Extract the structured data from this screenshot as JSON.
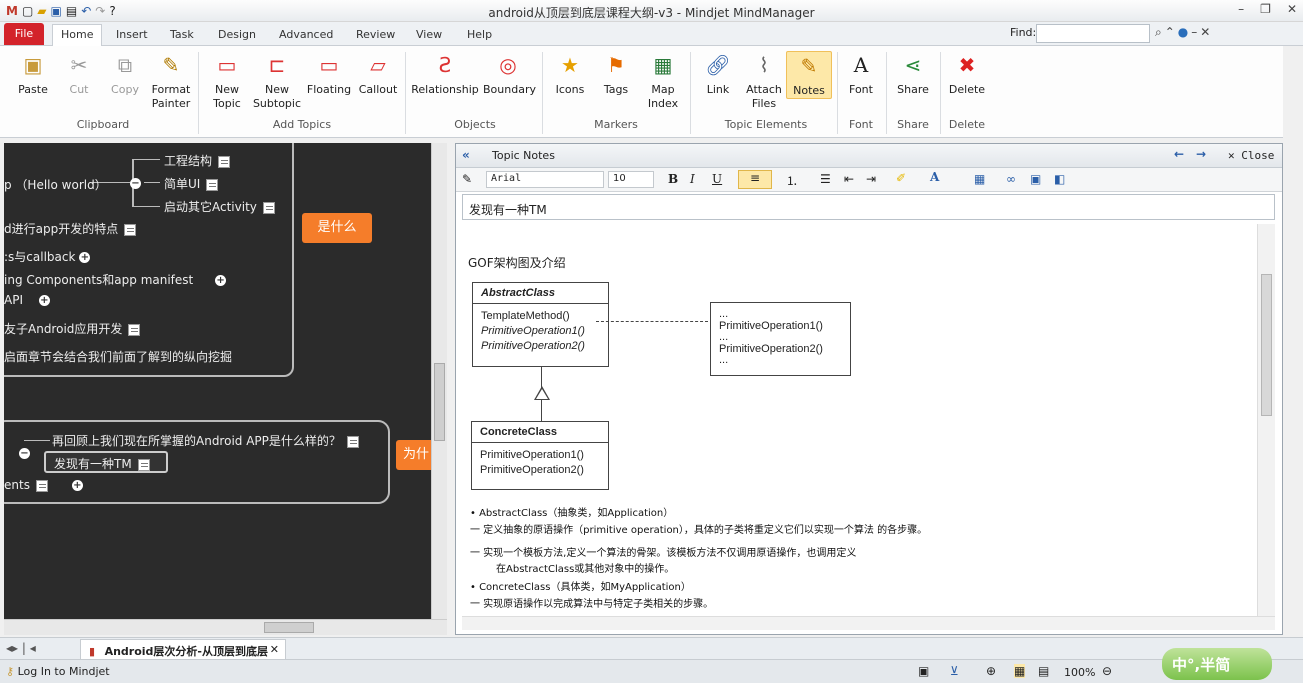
{
  "window": {
    "title": "android从顶层到底层课程大纲-v3 - Mindjet MindManager"
  },
  "ribbon_tabs": [
    "File",
    "Home",
    "Insert",
    "Task",
    "Design",
    "Advanced",
    "Review",
    "View",
    "Help"
  ],
  "find": {
    "label": "Find:",
    "value": ""
  },
  "ribbon": {
    "clipboard": {
      "paste": "Paste",
      "cut": "Cut",
      "copy": "Copy",
      "format_painter": "Format Painter",
      "group": "Clipboard"
    },
    "add_topics": {
      "new_topic": "New Topic",
      "new_subtopic": "New Subtopic",
      "floating": "Floating",
      "callout": "Callout",
      "group": "Add Topics"
    },
    "objects": {
      "relationship": "Relationship",
      "boundary": "Boundary",
      "group": "Objects"
    },
    "markers": {
      "icons": "Icons",
      "tags": "Tags",
      "map_index": "Map Index",
      "group": "Markers"
    },
    "topic_elements": {
      "link": "Link",
      "attach_files": "Attach Files",
      "notes": "Notes",
      "group": "Topic Elements"
    },
    "font": {
      "font": "Font",
      "group": "Font"
    },
    "share": {
      "share": "Share",
      "group": "Share"
    },
    "delete": {
      "delete": "Delete",
      "group": "Delete"
    }
  },
  "map": {
    "topics": [
      "工程结构",
      "p （Hello world）",
      "简单UI",
      "启动其它Activity",
      "d进行app开发的特点",
      "是什么",
      ":s与callback",
      "ing Components和app manifest",
      "API",
      "友子Android应用开发",
      "启面章节会结合我们前面了解到的纵向挖掘",
      "再回顾上我们现在所掌握的Android APP是什么样的？",
      "发现有一种TM",
      "为什",
      "ents"
    ]
  },
  "notes_panel": {
    "title": "Topic Notes",
    "close_label": "Close",
    "font": "Arial",
    "size": "10",
    "topic": "发现有一种TM",
    "heading": "GOF架构图及介绍",
    "uml": {
      "abstract_title": "AbstractClass",
      "abstract_methods": [
        "TemplateMethod()",
        "PrimitiveOperation1()",
        "PrimitiveOperation2()"
      ],
      "note_lines": [
        "...",
        "PrimitiveOperation1()",
        "...",
        "PrimitiveOperation2()",
        "..."
      ],
      "concrete_title": "ConcreteClass",
      "concrete_methods": [
        "PrimitiveOperation1()",
        "PrimitiveOperation2()"
      ]
    },
    "description": [
      "• AbstractClass（抽象类，如Application）",
      "一 定义抽象的原语操作（primitive operation），具体的子类将重定义它们以实现一个算法 的各步骤。",
      "一 实现一个模板方法,定义一个算法的骨架。该模板方法不仅调用原语操作，也调用定义",
      "在AbstractClass或其他对象中的操作。",
      "• ConcreteClass（具体类，如MyApplication）",
      "一 实现原语操作以完成算法中与特定子类相关的步骤。"
    ]
  },
  "document_tab": "Android层次分析-从顶层到底层",
  "status": {
    "login": "Log In to Mindjet",
    "zoom": "100%",
    "ime": "中°,半简"
  }
}
